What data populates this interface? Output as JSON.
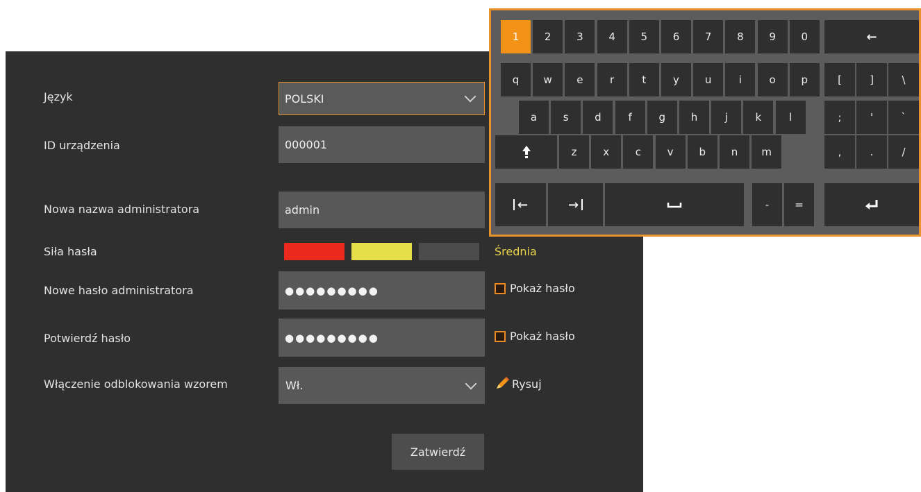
{
  "form": {
    "language": {
      "label": "Język",
      "value": "POLSKI"
    },
    "device_id": {
      "label": "ID urządzenia",
      "value": "000001"
    },
    "admin_name": {
      "label": "Nowa nazwa administratora",
      "value": "admin"
    },
    "strength": {
      "label": "Siła hasła",
      "level_text": "Średnia",
      "segments_filled": 2,
      "segments_total": 3,
      "colors": [
        "#ea2a1c",
        "#e5e04a",
        "#4c4c4c"
      ],
      "level_color": "#e7d24a"
    },
    "new_password": {
      "label": "Nowe hasło administratora",
      "value": "●●●●●●●●●",
      "show_label": "Pokaż hasło"
    },
    "confirm_password": {
      "label": "Potwierdź hasło",
      "value": "●●●●●●●●●",
      "show_label": "Pokaż hasło"
    },
    "pattern_unlock": {
      "label": "Włączenie odblokowania wzorem",
      "value": "Wł.",
      "draw_label": "Rysuj"
    },
    "submit_label": "Zatwierdź"
  },
  "keyboard": {
    "accent": "#f29318",
    "rows": [
      [
        "1",
        "2",
        "3",
        "4",
        "5",
        "6",
        "7",
        "8",
        "9",
        "0"
      ],
      [
        "q",
        "w",
        "e",
        "r",
        "t",
        "y",
        "u",
        "i",
        "o",
        "p"
      ],
      [
        "a",
        "s",
        "d",
        "f",
        "g",
        "h",
        "j",
        "k",
        "l"
      ],
      [
        "z",
        "x",
        "c",
        "v",
        "b",
        "n",
        "m"
      ]
    ],
    "right_rows": [
      [
        "[",
        "]",
        "\\"
      ],
      [
        ";",
        "'",
        "`"
      ],
      [
        ",",
        ".",
        "/"
      ]
    ],
    "active_key": "1",
    "icons": {
      "backspace": "←",
      "shift": "shift-arrow-icon",
      "cursor_left": "←",
      "cursor_right": "→",
      "space": "space-bar-icon",
      "enter": "enter-icon"
    },
    "extra": {
      "minus": "-",
      "equals": "="
    }
  }
}
